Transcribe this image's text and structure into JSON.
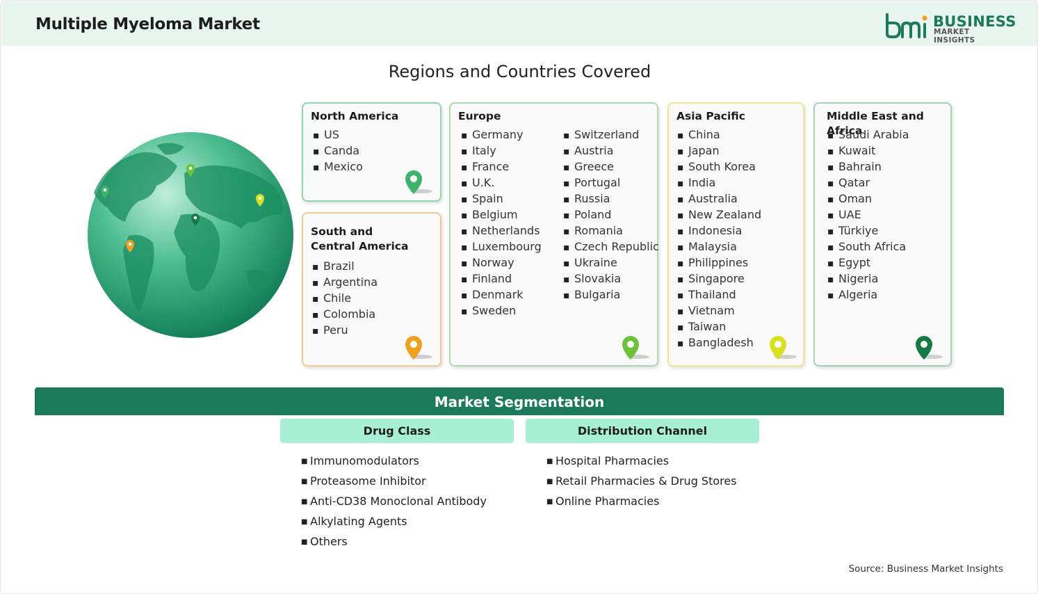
{
  "header": {
    "title": "Multiple Myeloma Market",
    "logo_primary": "BUSINESS",
    "logo_secondary": "MARKET INSIGHTS"
  },
  "regions_title": "Regions and Countries Covered",
  "regions": {
    "north_america": {
      "title": "North America",
      "countries": [
        "US",
        "Canda",
        "Mexico"
      ],
      "pin_color": "#3db36b"
    },
    "south_america": {
      "title_line1": "South and",
      "title_line2": "Central America",
      "countries": [
        "Brazil",
        "Argentina",
        "Chile",
        "Colombia",
        "Peru"
      ],
      "pin_color": "#f0a020"
    },
    "europe": {
      "title": "Europe",
      "countries_col1": [
        "Germany",
        "Italy",
        "France",
        "U.K.",
        "Spain",
        "Belgium",
        "Netherlands",
        "Luxembourg",
        "Norway",
        "Finland",
        "Denmark",
        "Sweden"
      ],
      "countries_col2": [
        "Switzerland",
        "Austria",
        "Greece",
        "Portugal",
        "Russia",
        "Poland",
        "Romania",
        "Czech Republic",
        "Ukraine",
        "Slovakia",
        "Bulgaria"
      ],
      "pin_color": "#6cc23a"
    },
    "asia_pacific": {
      "title": "Asia Pacific",
      "countries": [
        "China",
        "Japan",
        "South Korea",
        "India",
        "Australia",
        "New Zealand",
        "Indonesia",
        "Malaysia",
        "Philippines",
        "Singapore",
        "Thailand",
        "Vietnam",
        "Taiwan",
        "Bangladesh"
      ],
      "pin_color": "#d8e020"
    },
    "mea": {
      "title": "Middle East and Africa",
      "countries": [
        "Saudi Arabia",
        "Kuwait",
        "Bahrain",
        "Qatar",
        "Oman",
        "UAE",
        "Türkiye",
        "South Africa",
        "Egypt",
        "Nigeria",
        "Algeria"
      ],
      "pin_color": "#157a45"
    }
  },
  "segmentation": {
    "title": "Market Segmentation",
    "drug_class": {
      "label": "Drug Class",
      "items": [
        "Immunomodulators",
        "Proteasome Inhibitor",
        "Anti-CD38 Monoclonal Antibody",
        "Alkylating Agents",
        "Others"
      ]
    },
    "distribution": {
      "label": "Distribution Channel",
      "items": [
        "Hospital Pharmacies",
        "Retail Pharmacies & Drug Stores",
        "Online Pharmacies"
      ]
    }
  },
  "source": "Source: Business Market Insights",
  "colors": {
    "brand_green": "#1a7a5a",
    "header_bg": "#e8f6ef",
    "segment_tab_bg": "#a8f0d4",
    "na_border": "#8fd9b0",
    "sa_border": "#f5c98a",
    "eu_border": "#a8dcb0",
    "ap_border": "#eaea90",
    "mea_border": "#9fd4b4"
  }
}
